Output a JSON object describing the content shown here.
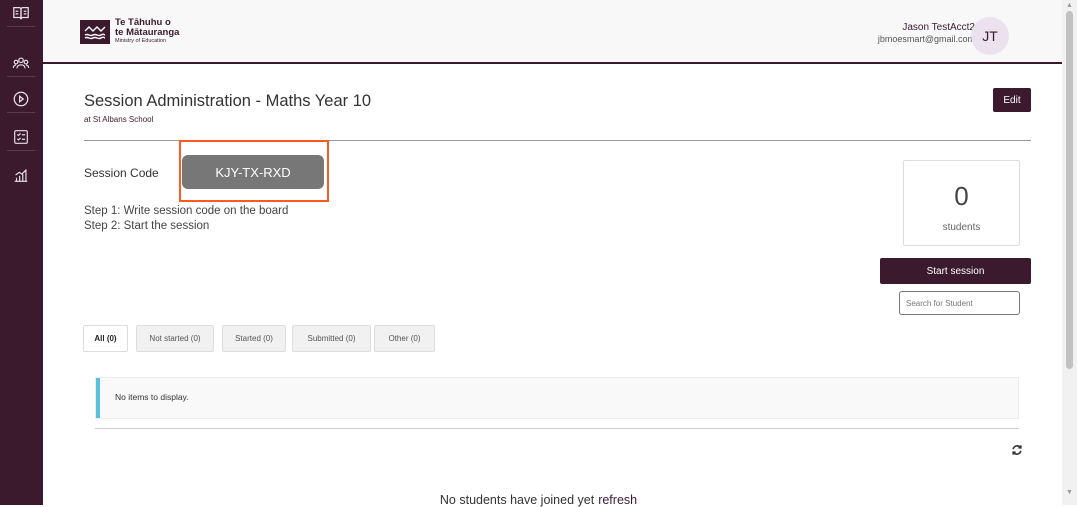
{
  "sidebar": {
    "items": [
      {
        "icon": "book-icon"
      },
      {
        "icon": "users-icon"
      },
      {
        "icon": "play-icon"
      },
      {
        "icon": "checklist-icon"
      },
      {
        "icon": "chart-icon"
      }
    ]
  },
  "header": {
    "logo_line1": "Te Tāhuhu o",
    "logo_line2": "te Mātauranga",
    "logo_line3": "Ministry of Education",
    "user_name": "Jason TestAcct2",
    "user_email": "jbmoesmart@gmail.com",
    "avatar_initials": "JT"
  },
  "main": {
    "title": "Session Administration - Maths Year 10",
    "subtitle": "at St Albans School",
    "edit_label": "Edit",
    "session_code_label": "Session Code",
    "session_code": "KJY-TX-RXD",
    "step1": "Step 1: Write session code on the board",
    "step2": "Step 2: Start the session",
    "student_count": "0",
    "students_label": "students",
    "start_label": "Start session",
    "search_placeholder": "Search for Student",
    "tabs": [
      {
        "label": "All (0)"
      },
      {
        "label": "Not started (0)"
      },
      {
        "label": "Started (0)"
      },
      {
        "label": "Submitted (0)"
      },
      {
        "label": "Other (0)"
      }
    ],
    "empty_text": "No items to display.",
    "footer_text": "No students have joined yet",
    "footer_link": "refresh"
  },
  "colors": {
    "brand": "#3b1a2e",
    "highlight": "#ff5a1f",
    "info_bar": "#5bc0de"
  }
}
